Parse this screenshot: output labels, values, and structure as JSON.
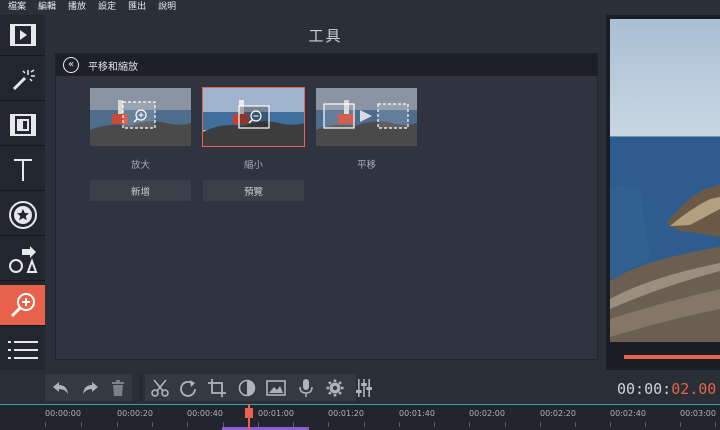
{
  "menu": [
    "檔案",
    "編輯",
    "播放",
    "設定",
    "匯出",
    "說明"
  ],
  "sidebar": {
    "items": [
      {
        "name": "import-media",
        "icon": "film-play-icon"
      },
      {
        "name": "filters",
        "icon": "magic-wand-icon"
      },
      {
        "name": "transitions",
        "icon": "transition-film-icon"
      },
      {
        "name": "titles",
        "icon": "text-t-icon"
      },
      {
        "name": "stickers",
        "icon": "star-sticker-icon"
      },
      {
        "name": "callouts",
        "icon": "shapes-arrow-icon"
      },
      {
        "name": "zoom-pan",
        "icon": "zoom-in-icon",
        "active": true
      },
      {
        "name": "more-tools",
        "icon": "menu-lines-icon"
      }
    ]
  },
  "tools": {
    "title": "工具",
    "panel_title": "平移和縮放",
    "cards": [
      {
        "label": "放大",
        "icon": "zoom-in-icon"
      },
      {
        "label": "縮小",
        "icon": "zoom-out-icon",
        "selected": true
      },
      {
        "label": "平移",
        "icon": "pan-arrow-icon"
      }
    ],
    "buttons": {
      "add": "新增",
      "preview": "預覽"
    }
  },
  "toolbar": {
    "icons": [
      "undo-icon",
      "redo-icon",
      "trash-icon",
      "scissors-icon",
      "rotate-icon",
      "crop-icon",
      "color-adjust-icon",
      "image-icon",
      "microphone-icon",
      "gear-icon",
      "equalizer-icon"
    ]
  },
  "timecode": {
    "main": "00:00:",
    "accent": "02.00"
  },
  "ruler": {
    "labels": [
      "00:00:00",
      "00:00:20",
      "00:00:40",
      "00:01:00",
      "00:01:20",
      "00:01:40",
      "00:02:00",
      "00:02:20",
      "00:02:40",
      "00:03:00"
    ]
  },
  "colors": {
    "accent": "#e8624c",
    "panel": "#2a2f39",
    "sidebar": "#22262f",
    "clip": "#8e5bd6"
  }
}
